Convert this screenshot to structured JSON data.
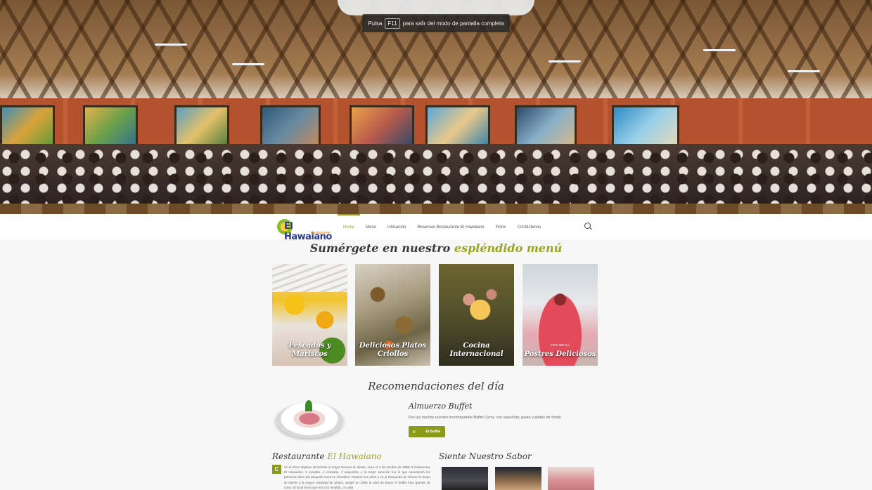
{
  "fullscreen_tooltip": {
    "before": "Pulsa",
    "key": "F11",
    "after": "para salir del modo de pantalla completa"
  },
  "logo": {
    "name": "El Hawaiano",
    "subtitle": "Restaurante"
  },
  "nav": {
    "items": [
      "Home",
      "Menú",
      "Ubicación",
      "Reservas Restaurante El Hawaiano",
      "Fotos",
      "Contáctenos"
    ],
    "active_index": 0
  },
  "menu_section": {
    "title_prefix": "Sumérgete en nuestro",
    "title_highlight": "espléndido menú",
    "tiles": [
      {
        "label": "Pescados y Mariscos"
      },
      {
        "label": "Deliciosos Platos Criollos"
      },
      {
        "label": "Cocina Internacional"
      },
      {
        "label": "Postres Deliciosos",
        "overlay": "VER MENÚ"
      }
    ]
  },
  "recommendations": {
    "title": "Recomendaciones del día",
    "item_name": "Almuerzo Buffet",
    "item_description": "Por las noches nuestro incomparable Buffet Cena, con salad bar, pasta y platos de fondo",
    "button_label": "El Buffet"
  },
  "about": {
    "title_prefix": "Restaurante",
    "title_highlight": "El Hawaiano",
    "dropcap": "C",
    "text_first": "on el único objetivo de brindar al mejor servicio al cliente, nace el 3 de octubre de 1989 el restaurante El Hawaiano. 6 mesitas, 4 entradas, 4 segundos, y la mejor atención fue lo que caracterizó los primeros años del pequeño local en chorrillos. Pasaron los años y en la búsqueda de ofrecer lo mejor al cliente y la mayor variedad de platos, surgió en 1996 la idea de hacer el buffet más grande de Lima. El local tenía que ser a la medida, ¡no alla"
  },
  "flavor": {
    "title": "Siente Nuestro Sabor"
  }
}
